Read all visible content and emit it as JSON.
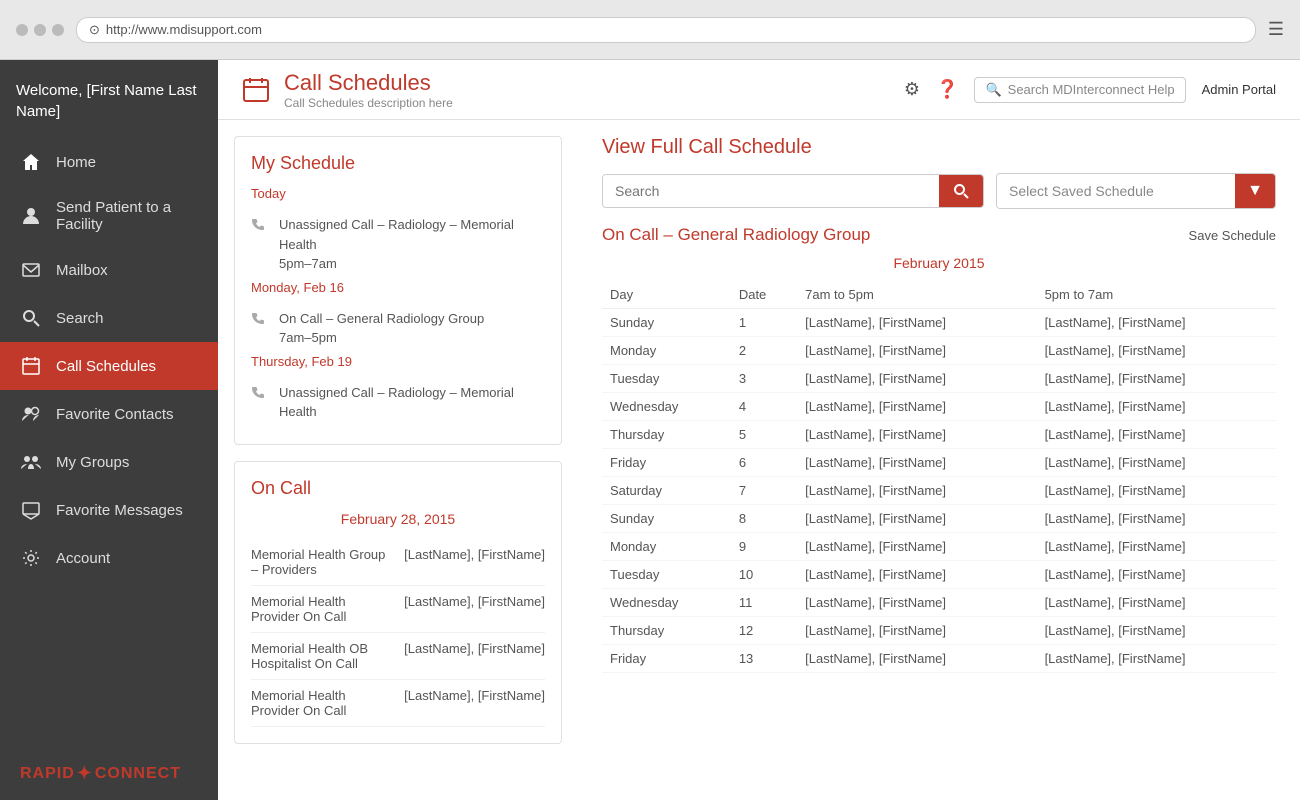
{
  "browser": {
    "url": "http://www.mdisupport.com"
  },
  "sidebar": {
    "welcome": "Welcome,\n[First Name\nLast Name]",
    "items": [
      {
        "id": "home",
        "label": "Home",
        "icon": "home"
      },
      {
        "id": "send-patient",
        "label": "Send Patient to a Facility",
        "icon": "person"
      },
      {
        "id": "mailbox",
        "label": "Mailbox",
        "icon": "mail"
      },
      {
        "id": "search",
        "label": "Search",
        "icon": "search"
      },
      {
        "id": "call-schedules",
        "label": "Call Schedules",
        "icon": "calendar",
        "active": true
      },
      {
        "id": "favorite-contacts",
        "label": "Favorite Contacts",
        "icon": "person-group"
      },
      {
        "id": "my-groups",
        "label": "My Groups",
        "icon": "group"
      },
      {
        "id": "favorite-messages",
        "label": "Favorite Messages",
        "icon": "message"
      },
      {
        "id": "account",
        "label": "Account",
        "icon": "gear"
      }
    ],
    "logo": "RAPID☆CONNECT"
  },
  "topbar": {
    "title": "Call Schedules",
    "subtitle": "Call Schedules description here",
    "search_placeholder": "Search MDInterconnect Help",
    "admin_label": "Admin Portal"
  },
  "my_schedule": {
    "title": "My Schedule",
    "sections": [
      {
        "date_label": "Today",
        "items": [
          {
            "text": "Unassigned Call – Radiology – Memorial Health",
            "time": "5pm–7am"
          }
        ]
      },
      {
        "date_label": "Monday, Feb 16",
        "items": [
          {
            "text": "On Call – General Radiology Group",
            "time": "7am–5pm"
          }
        ]
      },
      {
        "date_label": "Thursday, Feb 19",
        "items": [
          {
            "text": "Unassigned Call – Radiology – Memorial Health",
            "time": ""
          }
        ]
      }
    ]
  },
  "on_call": {
    "title": "On Call",
    "date": "February 28, 2015",
    "items": [
      {
        "group": "Memorial Health Group – Providers",
        "name": "[LastName], [FirstName]"
      },
      {
        "group": "Memorial Health Provider On Call",
        "name": "[LastName], [FirstName]"
      },
      {
        "group": "Memorial Health OB Hospitalist On Call",
        "name": "[LastName], [FirstName]"
      },
      {
        "group": "Memorial Health Provider On Call",
        "name": "[LastName], [FirstName]"
      }
    ]
  },
  "full_schedule": {
    "title": "View Full Call Schedule",
    "group_title": "On Call – General Radiology Group",
    "save_label": "Save Schedule",
    "month": "February 2015",
    "search_placeholder": "Search",
    "select_placeholder": "Select Saved Schedule",
    "columns": [
      "Day",
      "Date",
      "7am to 5pm",
      "5pm to 7am"
    ],
    "rows": [
      {
        "day": "Sunday",
        "date": "1",
        "morning": "[LastName], [FirstName]",
        "night": "[LastName], [FirstName]"
      },
      {
        "day": "Monday",
        "date": "2",
        "morning": "[LastName], [FirstName]",
        "night": "[LastName], [FirstName]"
      },
      {
        "day": "Tuesday",
        "date": "3",
        "morning": "[LastName], [FirstName]",
        "night": "[LastName], [FirstName]"
      },
      {
        "day": "Wednesday",
        "date": "4",
        "morning": "[LastName], [FirstName]",
        "night": "[LastName], [FirstName]"
      },
      {
        "day": "Thursday",
        "date": "5",
        "morning": "[LastName], [FirstName]",
        "night": "[LastName], [FirstName]"
      },
      {
        "day": "Friday",
        "date": "6",
        "morning": "[LastName], [FirstName]",
        "night": "[LastName], [FirstName]"
      },
      {
        "day": "Saturday",
        "date": "7",
        "morning": "[LastName], [FirstName]",
        "night": "[LastName], [FirstName]"
      },
      {
        "day": "Sunday",
        "date": "8",
        "morning": "[LastName], [FirstName]",
        "night": "[LastName], [FirstName]"
      },
      {
        "day": "Monday",
        "date": "9",
        "morning": "[LastName], [FirstName]",
        "night": "[LastName], [FirstName]"
      },
      {
        "day": "Tuesday",
        "date": "10",
        "morning": "[LastName], [FirstName]",
        "night": "[LastName], [FirstName]"
      },
      {
        "day": "Wednesday",
        "date": "11",
        "morning": "[LastName], [FirstName]",
        "night": "[LastName], [FirstName]"
      },
      {
        "day": "Thursday",
        "date": "12",
        "morning": "[LastName], [FirstName]",
        "night": "[LastName], [FirstName]"
      },
      {
        "day": "Friday",
        "date": "13",
        "morning": "[LastName], [FirstName]",
        "night": "[LastName], [FirstName]"
      }
    ]
  },
  "colors": {
    "accent": "#c0392b",
    "sidebar_bg": "#3d3d3d",
    "active_nav": "#c0392b"
  }
}
